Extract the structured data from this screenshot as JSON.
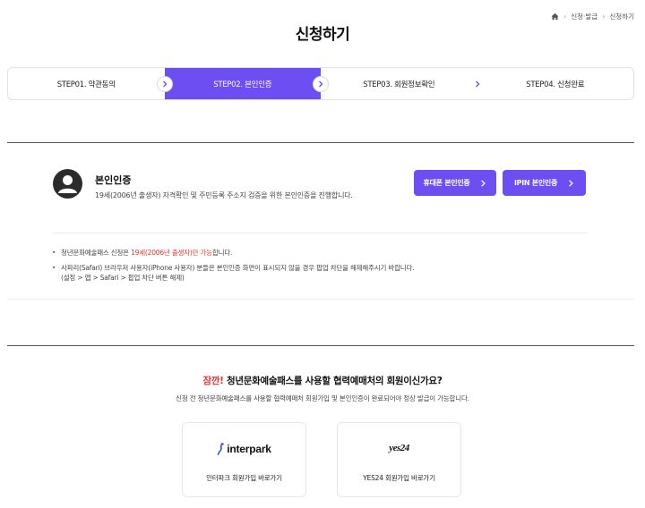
{
  "breadcrumb": {
    "items": [
      "신청·발급",
      "신청하기"
    ]
  },
  "page_title": "신청하기",
  "steps": [
    {
      "label": "STEP01. 약관동의",
      "active": false
    },
    {
      "label": "STEP02. 본인인증",
      "active": true
    },
    {
      "label": "STEP03. 회원정보확인",
      "active": false
    },
    {
      "label": "STEP04. 신청완료",
      "active": false
    }
  ],
  "auth": {
    "title": "본인인증",
    "description": "19세(2006년 출생자) 자격확인 및 주민등록 주소지 검증을 위한 본인인증을 진행합니다.",
    "phone_button": "휴대폰 본인인증",
    "ipin_button": "IPIN 본인인증"
  },
  "notes": {
    "note1_prefix": "청년문화예술패스 신청은 ",
    "note1_highlight": "19세(2006년 출생자)만 가능",
    "note1_suffix": "합니다.",
    "note2_line1": "사파리(Safari) 브라우저 사용자(iPhone 사용자) 분들은 본인인증 화면이 표시되지 않을 경우 팝업 차단을 해제해주시기 바랍니다.",
    "note2_line2": "(설정 > 앱 > Safari > 팝업 차단 버튼 해제)"
  },
  "member": {
    "title_highlight": "잠깐!",
    "title_rest": " 청년문화예술패스를 사용할 협력예매처의 회원이신가요?",
    "description": "신청 전 청년문화예술패스를 사용할 협력예매처 회원가입 및 본인인증이 완료되어야 정상 발급이 가능합니다."
  },
  "partners": {
    "interpark": {
      "logo_text": "interpark",
      "label": "인터파크 회원가입 바로가기"
    },
    "yes24": {
      "logo_text": "yes24",
      "label": "YES24 회원가입 바로가기"
    }
  },
  "colors": {
    "accent": "#6c4ef2",
    "highlight": "#e8322f",
    "avatar": "#2b2b2b"
  },
  "icons": {
    "home": "home-icon",
    "step_arrow": "chevron-right-icon",
    "button_arrow": "chevron-right-icon",
    "avatar": "user-icon"
  }
}
